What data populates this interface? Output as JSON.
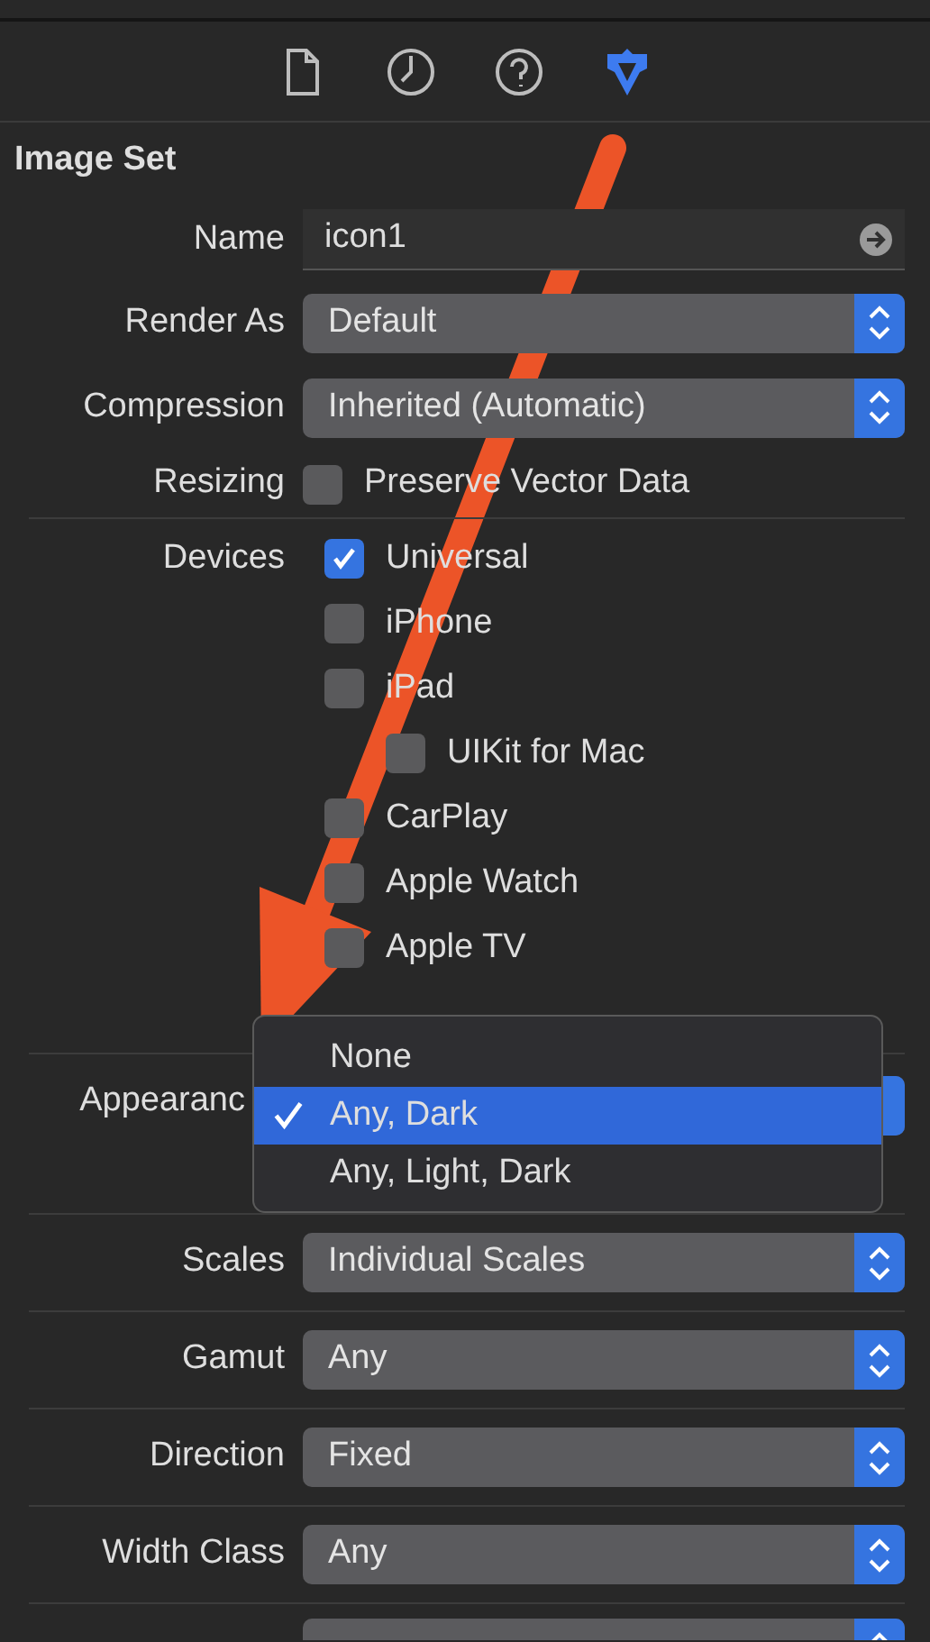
{
  "toolbar": {
    "tabs": [
      {
        "kind": "file",
        "selected": false
      },
      {
        "kind": "history",
        "selected": false
      },
      {
        "kind": "help",
        "selected": false
      },
      {
        "kind": "attributes",
        "selected": true
      }
    ]
  },
  "section_title": "Image Set",
  "fields": [
    {
      "kind": "text",
      "label": "Name",
      "value": "icon1"
    },
    {
      "kind": "select",
      "label": "Render As",
      "value": "Default"
    },
    {
      "kind": "select",
      "label": "Compression",
      "value": "Inherited (Automatic)"
    },
    {
      "kind": "checkbox",
      "label": "Resizing",
      "option": "Preserve Vector Data",
      "checked": false
    }
  ],
  "devices": {
    "label": "Devices",
    "items": [
      {
        "label": "Universal",
        "checked": true
      },
      {
        "label": "iPhone",
        "checked": false
      },
      {
        "label": "iPad",
        "checked": false,
        "children": [
          {
            "label": "UIKit for Mac",
            "checked": false
          }
        ]
      },
      {
        "label": "CarPlay",
        "checked": false
      },
      {
        "label": "Apple Watch",
        "checked": false
      },
      {
        "label": "Apple TV",
        "checked": false
      }
    ]
  },
  "appearance": {
    "label": "Appearanc",
    "menu": [
      {
        "label": "None",
        "selected": false
      },
      {
        "label": "Any, Dark",
        "selected": true
      },
      {
        "label": "Any, Light, Dark",
        "selected": false
      }
    ]
  },
  "more_fields": [
    {
      "label": "Scales",
      "value": "Individual Scales"
    },
    {
      "label": "Gamut",
      "value": "Any"
    },
    {
      "label": "Direction",
      "value": "Fixed"
    },
    {
      "label": "Width Class",
      "value": "Any"
    }
  ],
  "annotation": {
    "kind": "arrow"
  }
}
